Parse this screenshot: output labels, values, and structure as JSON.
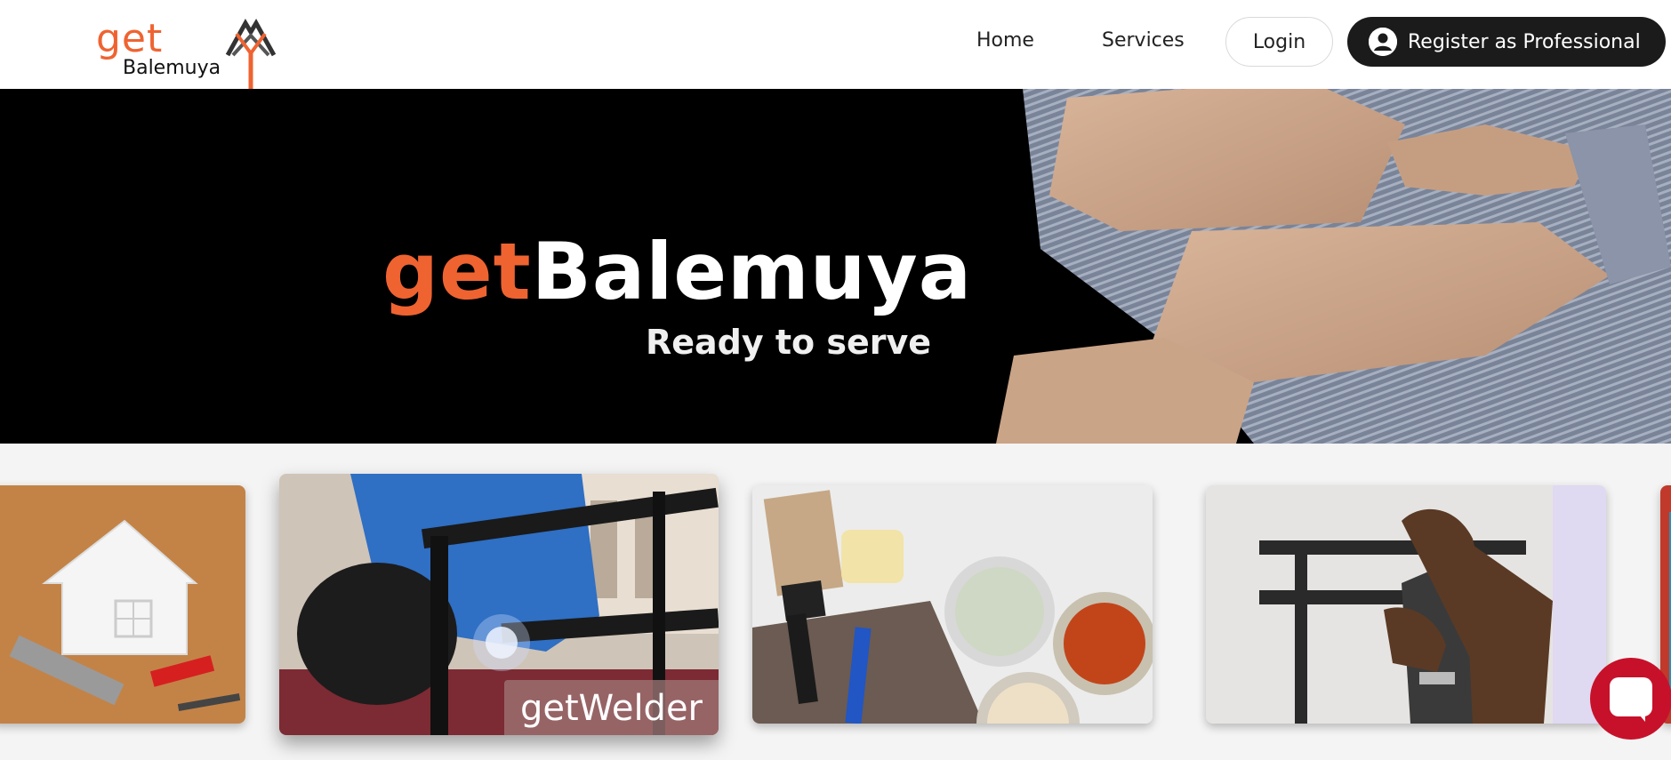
{
  "header": {
    "logo": {
      "prefix": "get",
      "name": "Balemuya"
    },
    "nav": {
      "home": "Home",
      "services": "Services",
      "login": "Login",
      "register": "Register as Professional"
    }
  },
  "hero": {
    "title_prefix": "get",
    "title_brand": "Balemuya",
    "subtitle": "Ready to serve"
  },
  "cards": [
    {
      "label": ""
    },
    {
      "label": "getWelder"
    },
    {
      "label": ""
    },
    {
      "label": ""
    }
  ],
  "colors": {
    "accent": "#ef6331",
    "dark": "#1b1b1b",
    "chat": "#c7112a"
  },
  "icons": {
    "user": "user-circle-icon",
    "chat": "chat-icon"
  }
}
